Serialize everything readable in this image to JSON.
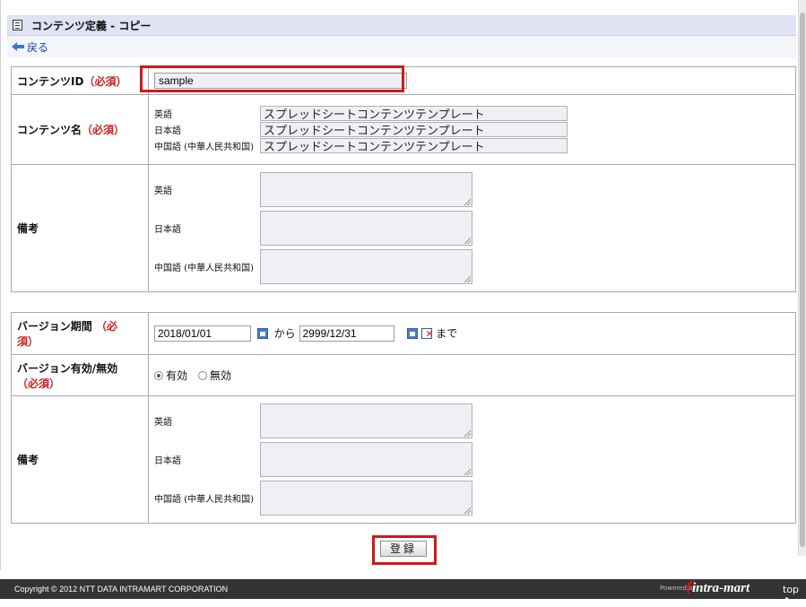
{
  "window": {
    "title": "コンテンツ定義 - コピー",
    "back": "戻る"
  },
  "labels": {
    "content_id": "コンテンツID",
    "content_name": "コンテンツ名",
    "remarks": "備考",
    "version_period": "バージョン期間",
    "version_valid": "バージョン有効/無効",
    "required": "（必須）",
    "required_split_a": "（必",
    "required_split_b": "須）"
  },
  "languages": {
    "en": "英語",
    "ja": "日本語",
    "zh": "中国語 (中華人民共和国)"
  },
  "content_id_value": "sample",
  "content_names": {
    "en": "スプレッドシートコンテンツテンプレート",
    "ja": "スプレッドシートコンテンツテンプレート",
    "zh": "スプレッドシートコンテンツテンプレート"
  },
  "period": {
    "from": "2018/01/01",
    "from_word": "から",
    "to": "2999/12/31",
    "to_word": "まで"
  },
  "validity": {
    "valid": "有効",
    "invalid": "無効",
    "selected": "valid"
  },
  "submit_label": "登録",
  "footer": {
    "copyright": "Copyright © 2012 NTT DATA INTRAMART CORPORATION",
    "powered_by": "Powered by",
    "brand": "intra-mart",
    "top": "top ↑"
  },
  "colors": {
    "title_bar": "#dfe3f3",
    "required": "#cc2222",
    "highlight": "#cc1a1a",
    "footer": "#333333"
  }
}
